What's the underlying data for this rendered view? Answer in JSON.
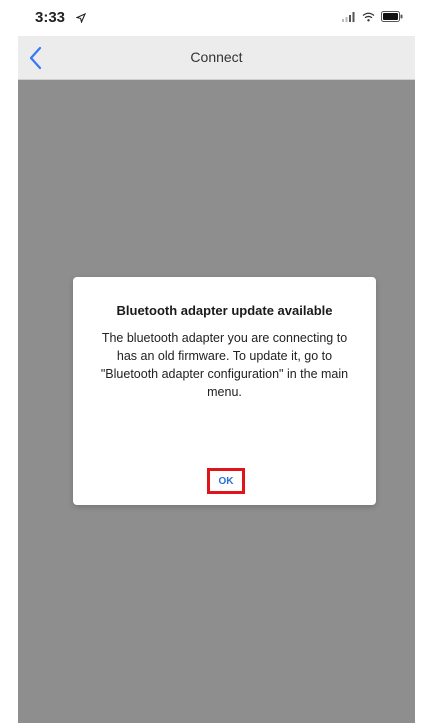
{
  "status_bar": {
    "time": "3:33",
    "icons": [
      "location-icon",
      "signal-icon",
      "wifi-icon",
      "battery-icon"
    ]
  },
  "nav": {
    "title": "Connect",
    "back_icon": "chevron-left-icon"
  },
  "dialog": {
    "title": "Bluetooth adapter update available",
    "message": "The bluetooth adapter you are connecting to has an old firmware. To update it, go to \"Bluetooth adapter configuration\" in the main menu.",
    "ok_label": "OK"
  },
  "colors": {
    "overlay": "#8e8e8e",
    "accent": "#2b6fd6",
    "highlight": "#e0141a"
  }
}
